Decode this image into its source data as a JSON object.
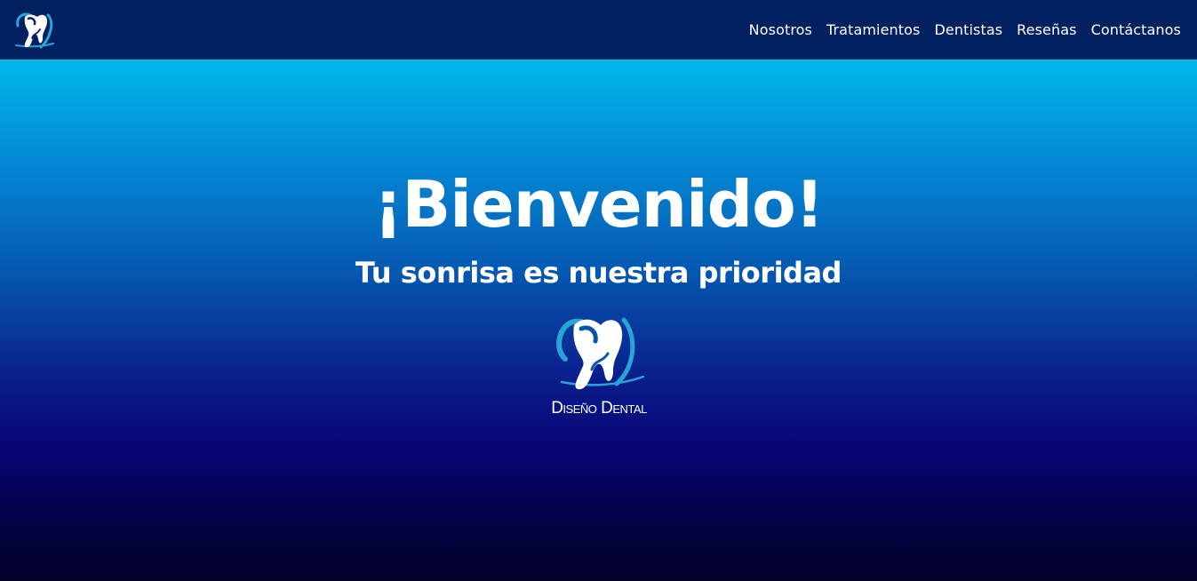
{
  "nav": {
    "logo_icon": "tooth-logo-icon",
    "links": [
      {
        "label": "Nosotros"
      },
      {
        "label": "Tratamientos"
      },
      {
        "label": "Dentistas"
      },
      {
        "label": "Reseñas"
      },
      {
        "label": "Contáctanos"
      }
    ]
  },
  "hero": {
    "title": "¡Bienvenido!",
    "subtitle": "Tu sonrisa es nuestra prioridad",
    "logo_text": "Diseño Dental",
    "logo_icon": "tooth-logo-icon"
  },
  "colors": {
    "nav_background": "#032061",
    "hero_gradient_top": "#00b7ec",
    "hero_gradient_mid": "#0a1b8a",
    "hero_gradient_bottom": "#010027",
    "logo_accent": "#2aa4d6",
    "text": "#ffffff"
  }
}
